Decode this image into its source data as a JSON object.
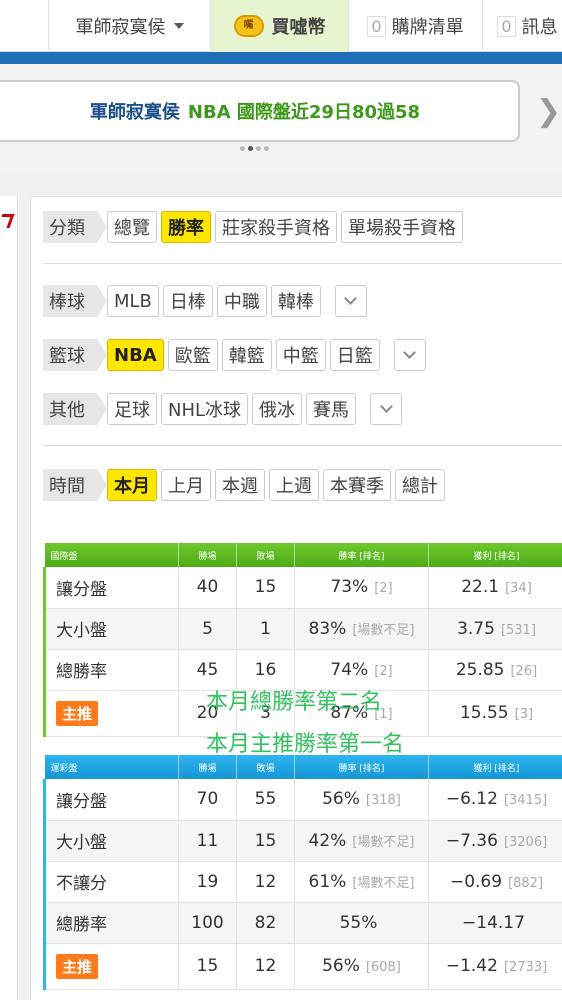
{
  "nav": {
    "user": "軍師寂寞侯",
    "coin_icon": "嘴",
    "coin_label": "買噓幣",
    "cart_count": "0",
    "cart_label": "購牌清單",
    "msg_count": "0",
    "msg_label": "訊息"
  },
  "banner": {
    "user": "軍師寂寞侯",
    "text": "NBA 國際盤近29日80過58"
  },
  "filters": {
    "category": {
      "label": "分類",
      "items": [
        "總覽",
        "勝率",
        "莊家殺手資格",
        "單場殺手資格"
      ],
      "selected": 1
    },
    "baseball": {
      "label": "棒球",
      "items": [
        "MLB",
        "日棒",
        "中職",
        "韓棒"
      ]
    },
    "basketball": {
      "label": "籃球",
      "items": [
        "NBA",
        "歐籃",
        "韓籃",
        "中籃",
        "日籃"
      ],
      "selected": 0
    },
    "other": {
      "label": "其他",
      "items": [
        "足球",
        "NHL冰球",
        "俄冰",
        "賽馬"
      ]
    },
    "time": {
      "label": "時間",
      "items": [
        "本月",
        "上月",
        "本週",
        "上週",
        "本賽季",
        "總計"
      ],
      "selected": 0
    }
  },
  "intl_table": {
    "headers": [
      "國際盤",
      "勝場",
      "敗場",
      "勝率 [排名]",
      "獲利 [排名]"
    ],
    "rows": [
      {
        "name": "讓分盤",
        "win": "40",
        "loss": "15",
        "rate": "73%",
        "rate_rank": "[2]",
        "profit": "22.1",
        "profit_rank": "[34]"
      },
      {
        "name": "大小盤",
        "win": "5",
        "loss": "1",
        "rate": "83%",
        "rate_rank": "[場數不足]",
        "profit": "3.75",
        "profit_rank": "[531]"
      },
      {
        "name": "總勝率",
        "win": "45",
        "loss": "16",
        "rate": "74%",
        "rate_rank": "[2]",
        "profit": "25.85",
        "profit_rank": "[26]"
      }
    ],
    "pick": {
      "name": "主推",
      "win": "20",
      "loss": "3",
      "rate": "87%",
      "rate_rank": "[1]",
      "profit": "15.55",
      "profit_rank": "[3]"
    }
  },
  "overlay": {
    "line1": "本月總勝率第二名",
    "line2": "本月主推勝率第一名"
  },
  "lottery_table": {
    "headers": [
      "運彩盤",
      "勝場",
      "敗場",
      "勝率 [排名]",
      "獲利 [排名]"
    ],
    "rows": [
      {
        "name": "讓分盤",
        "win": "70",
        "loss": "55",
        "rate": "56%",
        "rate_rank": "[318]",
        "profit": "−6.12",
        "profit_rank": "[3415]"
      },
      {
        "name": "大小盤",
        "win": "11",
        "loss": "15",
        "rate": "42%",
        "rate_rank": "[場數不足]",
        "profit": "−7.36",
        "profit_rank": "[3206]"
      },
      {
        "name": "不讓分",
        "win": "19",
        "loss": "12",
        "rate": "61%",
        "rate_rank": "[場數不足]",
        "profit": "−0.69",
        "profit_rank": "[882]"
      },
      {
        "name": "總勝率",
        "win": "100",
        "loss": "82",
        "rate": "55%",
        "rate_rank": "",
        "profit": "−14.17",
        "profit_rank": ""
      }
    ],
    "pick": {
      "name": "主推",
      "win": "15",
      "loss": "12",
      "rate": "56%",
      "rate_rank": "[608]",
      "profit": "−1.42",
      "profit_rank": "[2733]"
    }
  },
  "colors": {
    "brand_blue": "#1e6fb8",
    "selected_yellow": "#ffe600",
    "intl_green": "#6fc92e",
    "lottery_blue": "#2eb4ee",
    "pick_orange": "#ff7a1a",
    "overlay_green": "#34c25f"
  }
}
